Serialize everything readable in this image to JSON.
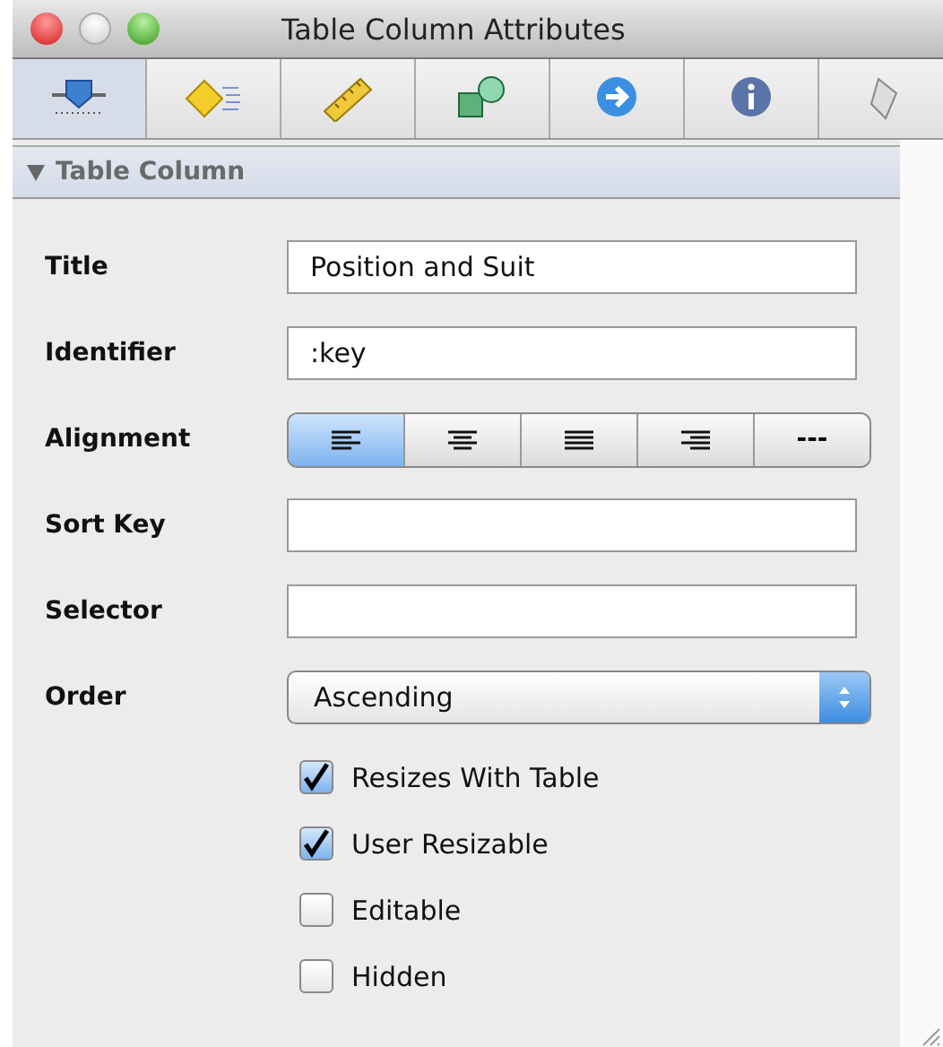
{
  "window": {
    "title": "Table Column Attributes"
  },
  "tabs": [
    {
      "kind": "attributes",
      "selected": true
    },
    {
      "kind": "effects",
      "selected": false
    },
    {
      "kind": "size",
      "selected": false
    },
    {
      "kind": "connections",
      "selected": false
    },
    {
      "kind": "bindings",
      "selected": false
    },
    {
      "kind": "info",
      "selected": false
    },
    {
      "kind": "script",
      "selected": false
    }
  ],
  "section": {
    "title": "Table Column",
    "expanded": true
  },
  "rows": [
    {
      "kind": "text",
      "label": "Title",
      "value": "Position and Suit"
    },
    {
      "kind": "text",
      "label": "Identifier",
      "value": ":key"
    },
    {
      "kind": "segmented",
      "label": "Alignment",
      "segments": [
        {
          "kind": "left",
          "selected": true
        },
        {
          "kind": "center",
          "selected": false
        },
        {
          "kind": "justified",
          "selected": false
        },
        {
          "kind": "right",
          "selected": false
        },
        {
          "kind": "natural",
          "label": "---",
          "selected": false
        }
      ]
    },
    {
      "kind": "text",
      "label": "Sort Key"
    },
    {
      "kind": "text",
      "label": "Selector"
    },
    {
      "kind": "popup",
      "label": "Order",
      "value": "Ascending"
    }
  ],
  "checkboxes": [
    {
      "label": "Resizes With Table",
      "checked": true
    },
    {
      "label": "User Resizable",
      "checked": true
    },
    {
      "label": "Editable",
      "checked": false
    },
    {
      "label": "Hidden",
      "checked": false
    }
  ]
}
